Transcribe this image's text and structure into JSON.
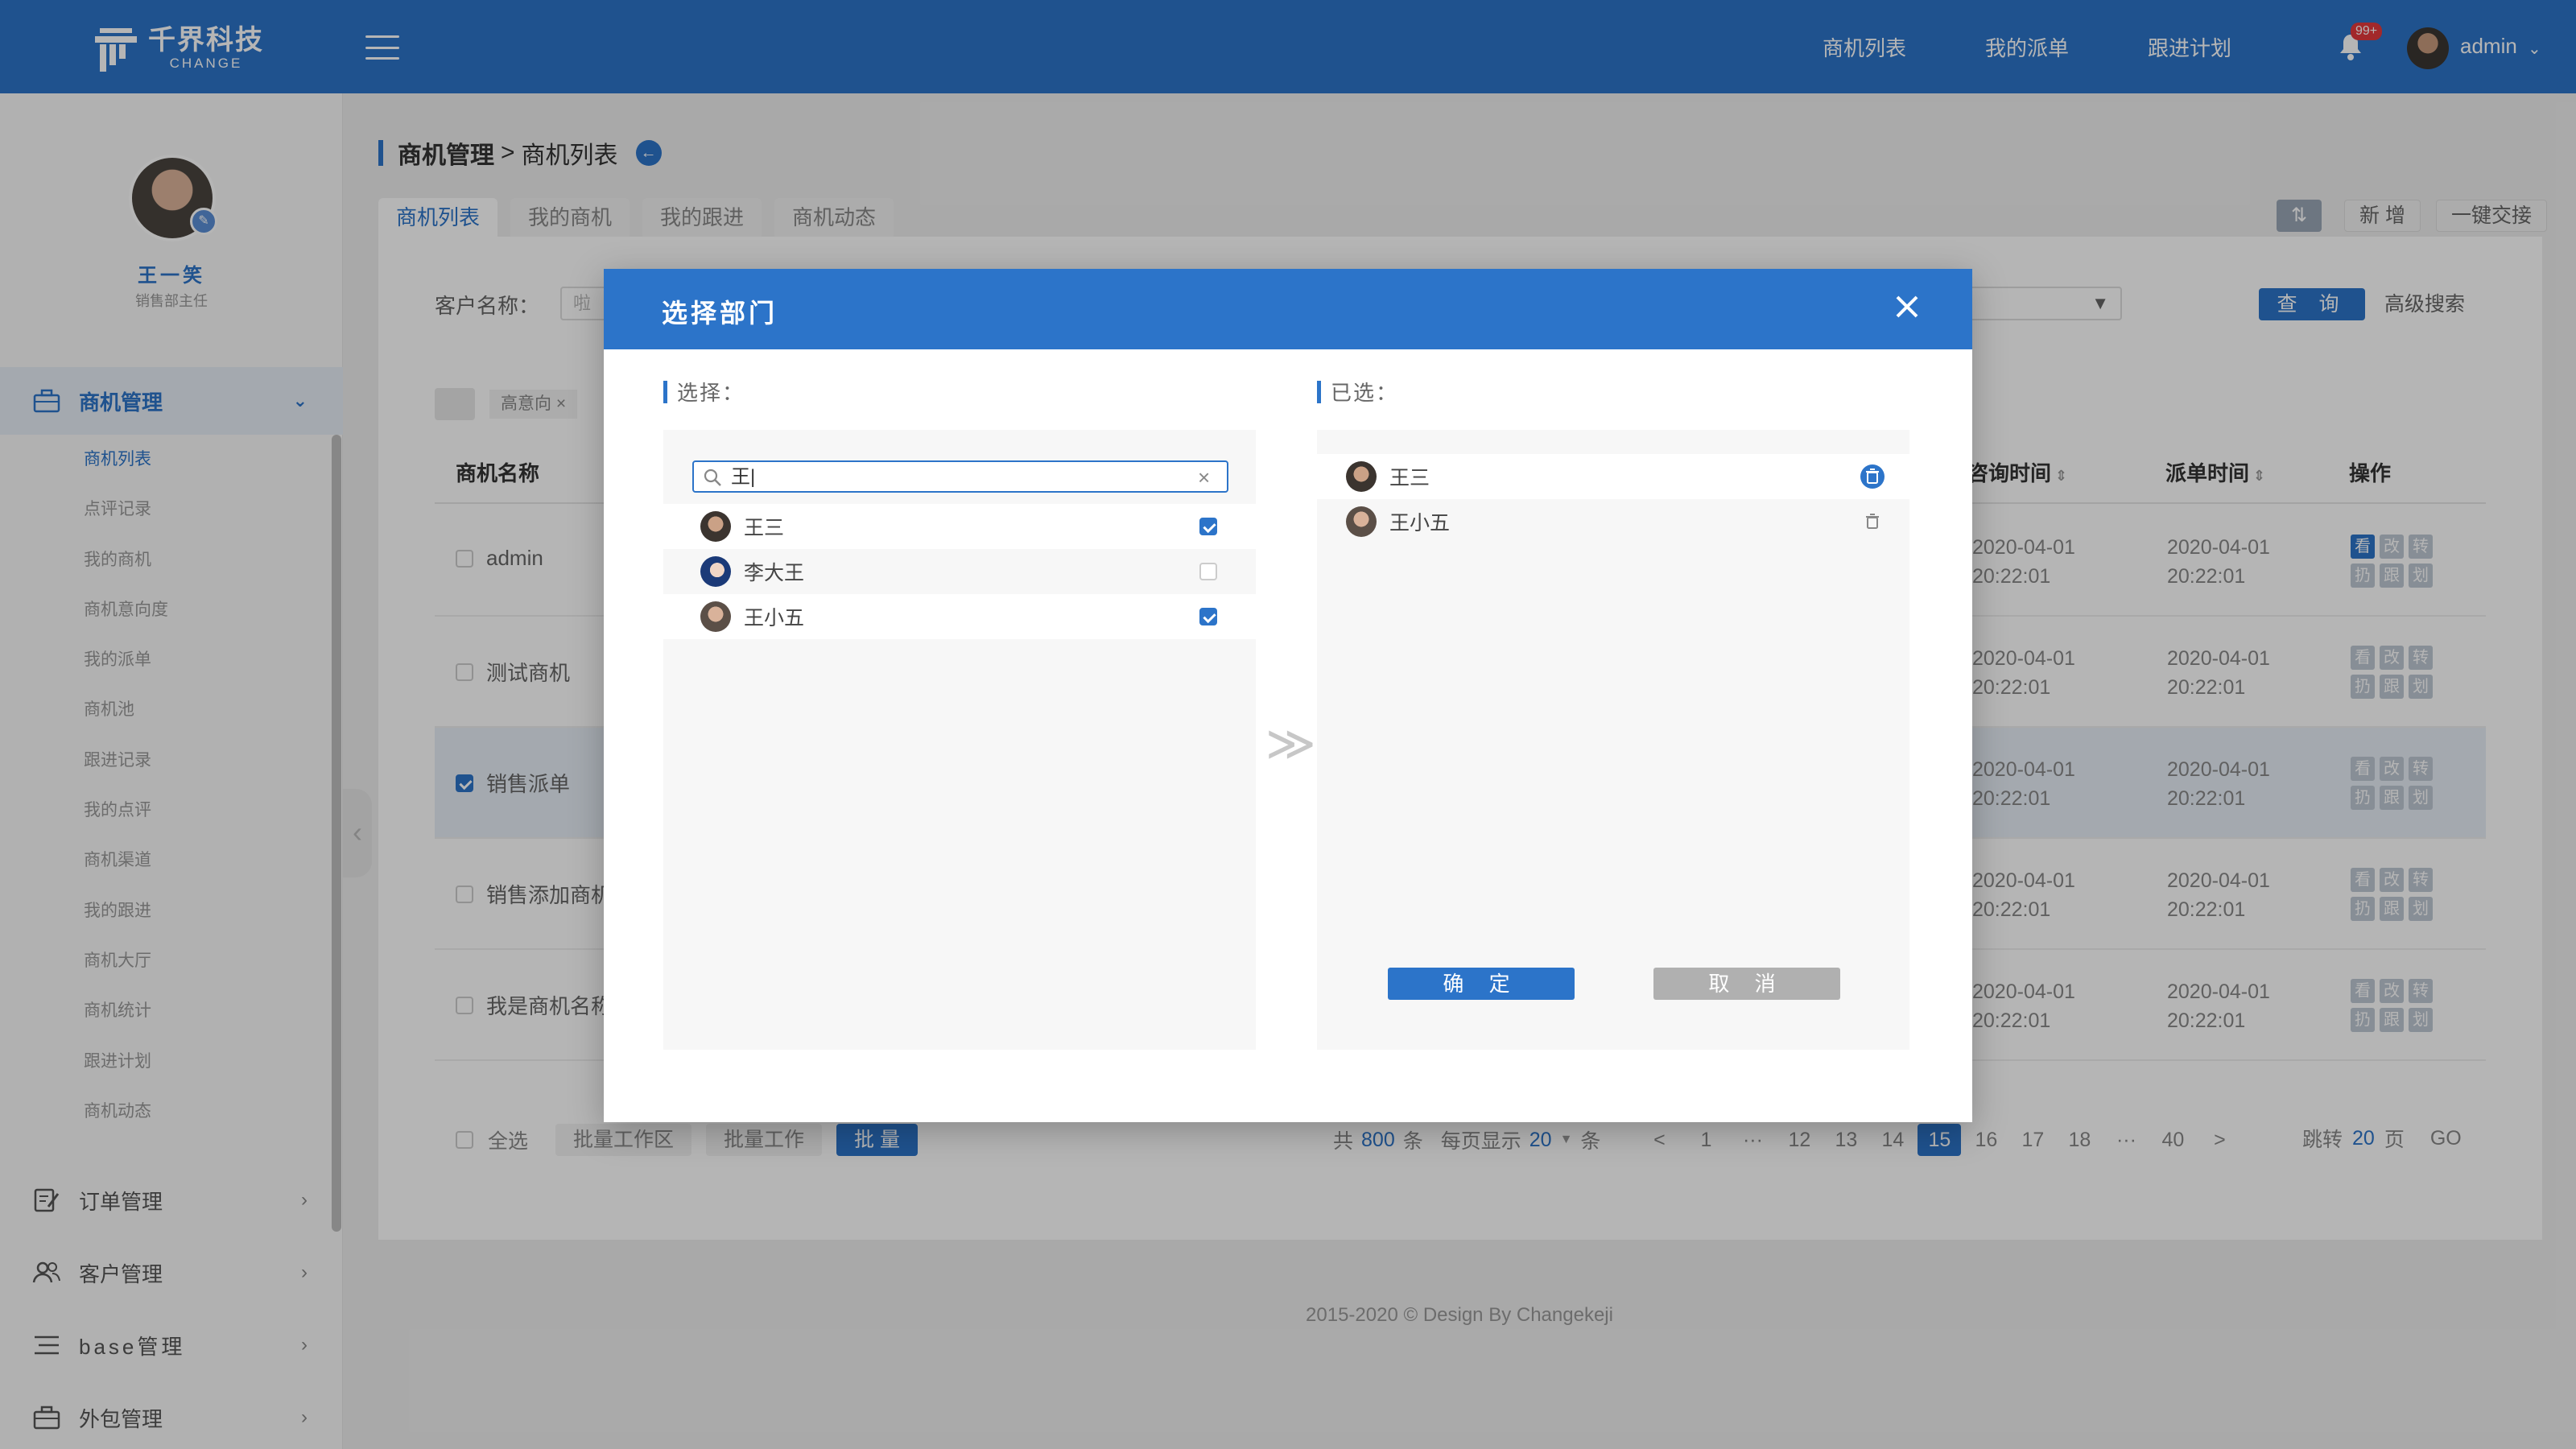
{
  "brand": {
    "name_cn": "千界科技",
    "name_en": "CHANGE"
  },
  "header": {
    "nav": [
      "商机列表",
      "我的派单",
      "跟进计划"
    ],
    "notification_badge": "99+",
    "user_name": "admin"
  },
  "profile": {
    "name": "王一笑",
    "role": "销售部主任"
  },
  "sidebar": {
    "active_group": "商机管理",
    "sub_items": [
      "商机列表",
      "点评记录",
      "我的商机",
      "商机意向度",
      "我的派单",
      "商机池",
      "跟进记录",
      "我的点评",
      "商机渠道",
      "我的跟进",
      "商机大厅",
      "商机统计",
      "跟进计划",
      "商机动态"
    ],
    "groups": [
      "订单管理",
      "客户管理",
      "base管理",
      "外包管理"
    ]
  },
  "breadcrumb": {
    "parent": "商机管理",
    "sep": ">",
    "current": "商机列表"
  },
  "tabs": [
    "商机列表",
    "我的商机",
    "我的跟进",
    "商机动态"
  ],
  "toolbar": {
    "add": "新 增",
    "handover": "一键交接"
  },
  "filter": {
    "label": "客户名称：",
    "placeholder": "啦",
    "query": "查 询",
    "advanced": "高级搜索"
  },
  "chip": {
    "label": "高意向",
    "close": "×"
  },
  "table": {
    "headers": {
      "name": "商机名称",
      "consult": "咨询时间",
      "dispatch": "派单时间",
      "ops": "操作"
    },
    "ops": [
      "看",
      "改",
      "转",
      "扔",
      "跟",
      "划"
    ],
    "rows": [
      {
        "name": "admin",
        "consult_date": "2020-04-01",
        "consult_time": "20:22:01",
        "dispatch_date": "2020-04-01",
        "dispatch_time": "20:22:01"
      },
      {
        "name": "测试商机",
        "consult_date": "2020-04-01",
        "consult_time": "20:22:01",
        "dispatch_date": "2020-04-01",
        "dispatch_time": "20:22:01"
      },
      {
        "name": "销售派单",
        "consult_date": "2020-04-01",
        "consult_time": "20:22:01",
        "dispatch_date": "2020-04-01",
        "dispatch_time": "20:22:01"
      },
      {
        "name": "销售添加商机",
        "consult_date": "2020-04-01",
        "consult_time": "20:22:01",
        "dispatch_date": "2020-04-01",
        "dispatch_time": "20:22:01"
      },
      {
        "name": "我是商机名称",
        "consult_date": "2020-04-01",
        "consult_time": "20:22:01",
        "dispatch_date": "2020-04-01",
        "dispatch_time": "20:22:01"
      }
    ]
  },
  "footer": {
    "select_all": "全选",
    "bulk": [
      "批量工作区",
      "批量工作",
      "批 量"
    ],
    "total_prefix": "共",
    "total": "800",
    "total_suffix": "条",
    "per_page_label": "每页显示",
    "per_page": "20",
    "per_page_suffix": "条",
    "pages": [
      "<",
      "1",
      "···",
      "12",
      "13",
      "14",
      "15",
      "16",
      "17",
      "18",
      "···",
      "40",
      ">"
    ],
    "current_page": "15",
    "jump_label": "跳转",
    "jump_value": "20",
    "jump_suffix": "页",
    "go": "GO"
  },
  "copyright": "2015-2020 © Design By Changekeji",
  "modal": {
    "title": "选择部门",
    "left_label": "选择：",
    "right_label": "已选：",
    "search_value": "王|",
    "candidates": [
      {
        "name": "王三",
        "checked": true
      },
      {
        "name": "李大王",
        "checked": false
      },
      {
        "name": "王小五",
        "checked": true
      }
    ],
    "selected": [
      "王三",
      "王小五"
    ],
    "arrow": "≫",
    "confirm": "确 定",
    "cancel": "取 消"
  }
}
